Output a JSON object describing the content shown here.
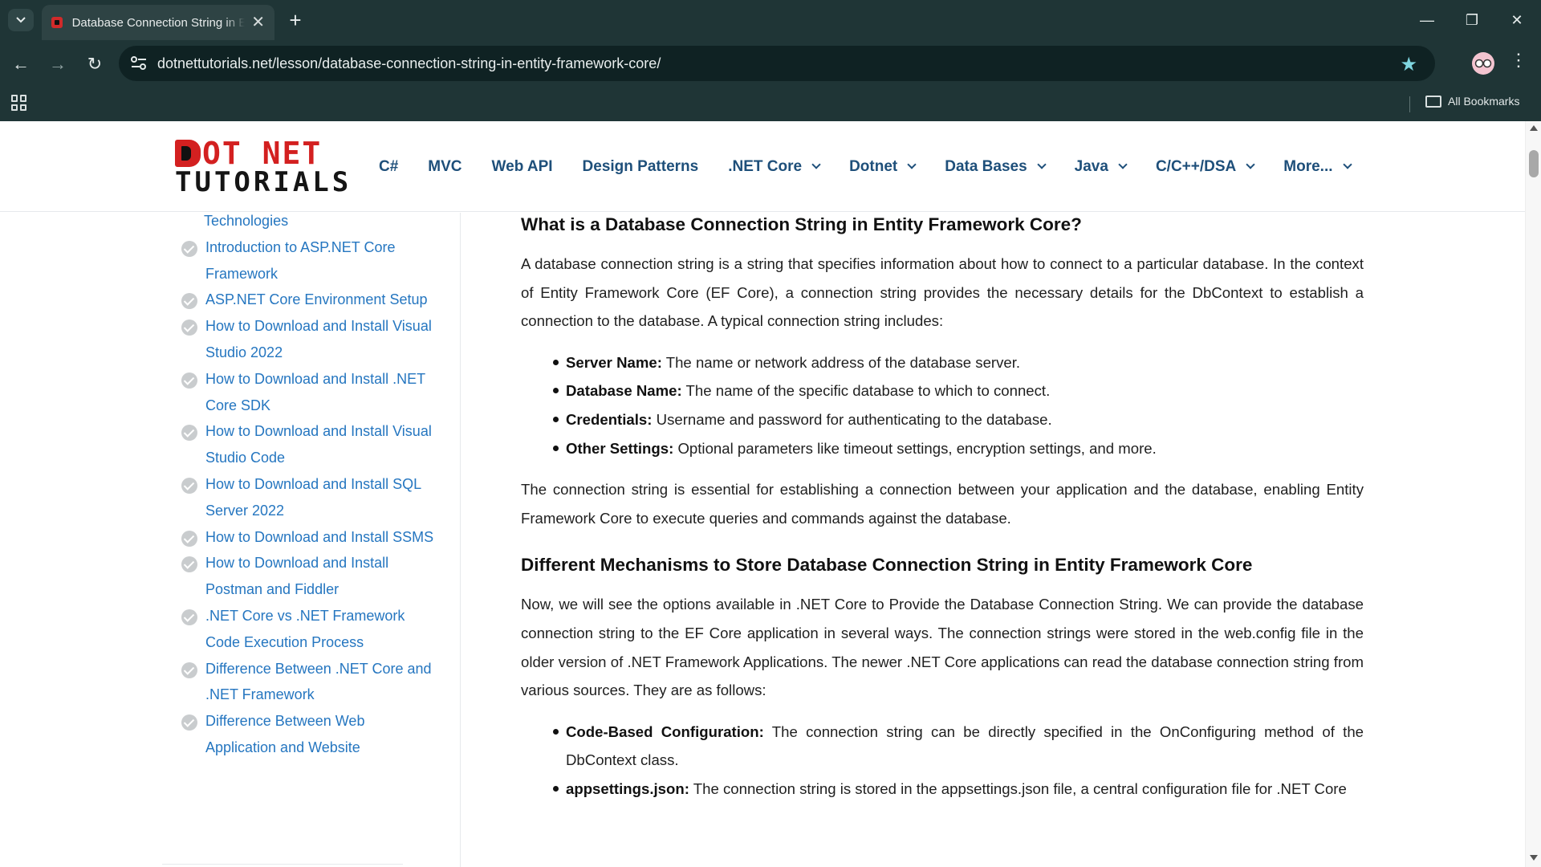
{
  "browser": {
    "tab_title": "Database Connection String in Entity Framework Core",
    "url_host": "dotnettutorials.net",
    "url_path": "/lesson/database-connection-string-in-entity-framework-core/",
    "new_tab_symbol": "+",
    "tab_close_symbol": "✕",
    "minimize_symbol": "—",
    "restore_symbol": "❐",
    "close_symbol": "✕",
    "back_symbol": "←",
    "forward_symbol": "→",
    "reload_symbol": "↻",
    "star_symbol": "★",
    "menu_symbol": "⋮",
    "all_bookmarks": "All Bookmarks",
    "accent_color": "#7fd6e0"
  },
  "site": {
    "logo_top": "OT NET",
    "logo_bottom": "TUTORIALS",
    "nav": [
      {
        "label": "C#",
        "dropdown": false
      },
      {
        "label": "MVC",
        "dropdown": false
      },
      {
        "label": "Web API",
        "dropdown": false
      },
      {
        "label": "Design Patterns",
        "dropdown": false
      },
      {
        "label": ".NET Core",
        "dropdown": true
      },
      {
        "label": "Dotnet",
        "dropdown": true
      },
      {
        "label": "Data Bases",
        "dropdown": true
      },
      {
        "label": "Java",
        "dropdown": true
      },
      {
        "label": "C/C++/DSA",
        "dropdown": true
      },
      {
        "label": "More...",
        "dropdown": true
      }
    ],
    "link_color": "#2576c0",
    "nav_color": "#1e4f7a"
  },
  "sidebar": {
    "items": [
      {
        "label": "Technologies",
        "icon": false
      },
      {
        "label": "Introduction to ASP.NET Core Framework",
        "icon": true
      },
      {
        "label": "ASP.NET Core Environment Setup",
        "icon": true
      },
      {
        "label": "How to Download and Install Visual Studio 2022",
        "icon": true
      },
      {
        "label": "How to Download and Install .NET Core SDK",
        "icon": true
      },
      {
        "label": "How to Download and Install Visual Studio Code",
        "icon": true
      },
      {
        "label": "How to Download and Install SQL Server 2022",
        "icon": true
      },
      {
        "label": "How to Download and Install SSMS",
        "icon": true
      },
      {
        "label": "How to Download and Install Postman and Fiddler",
        "icon": true
      },
      {
        "label": ".NET Core vs .NET Framework Code Execution Process",
        "icon": true
      },
      {
        "label": "Difference Between .NET Core and .NET Framework",
        "icon": true
      },
      {
        "label": "Difference Between Web Application and Website",
        "icon": true
      }
    ]
  },
  "article": {
    "h1": "What is a Database Connection String in Entity Framework Core?",
    "p1": "A database connection string is a string that specifies information about how to connect to a particular database. In the context of Entity Framework Core (EF Core), a connection string provides the necessary details for the DbContext to establish a connection to the database. A typical connection string includes:",
    "list1": [
      {
        "term": "Server Name:",
        "desc": " The name or network address of the database server."
      },
      {
        "term": "Database Name:",
        "desc": " The name of the specific database to which to connect."
      },
      {
        "term": "Credentials:",
        "desc": " Username and password for authenticating to the database."
      },
      {
        "term": "Other Settings:",
        "desc": " Optional parameters like timeout settings, encryption settings, and more."
      }
    ],
    "p2": "The connection string is essential for establishing a connection between your application and the database, enabling Entity Framework Core to execute queries and commands against the database.",
    "h2": "Different Mechanisms to Store Database Connection String in Entity Framework Core",
    "p3": "Now, we will see the options available in .NET Core to Provide the Database Connection String. We can provide the database connection string to the EF Core application in several ways. The connection strings were stored in the web.config file in the older version of .NET Framework Applications. The newer .NET Core applications can read the database connection string from various sources. They are as follows:",
    "list2": [
      {
        "term": "Code-Based Configuration:",
        "desc": " The connection string can be directly specified in the OnConfiguring method of the DbContext class."
      },
      {
        "term": "appsettings.json:",
        "desc": " The connection string is stored in the appsettings.json file, a central configuration file for .NET Core"
      }
    ]
  }
}
